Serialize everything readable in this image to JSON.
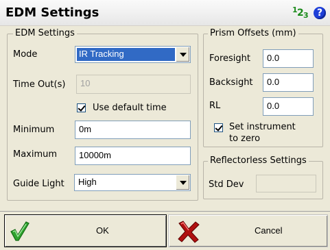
{
  "window": {
    "title": "EDM Settings"
  },
  "titlebar_icons": {
    "numeric": [
      "1",
      "2",
      "3"
    ],
    "help": "?"
  },
  "edm": {
    "legend": "EDM Settings",
    "mode_label": "Mode",
    "mode_value": "IR Tracking",
    "timeout_label": "Time Out(s)",
    "timeout_value": "10",
    "use_default_label": "Use default time",
    "use_default_checked": true,
    "minimum_label": "Minimum",
    "minimum_value": "0m",
    "maximum_label": "Maximum",
    "maximum_value": "10000m",
    "guide_label": "Guide Light",
    "guide_value": "High"
  },
  "prism": {
    "legend": "Prism Offsets (mm)",
    "foresight_label": "Foresight",
    "foresight_value": "0.0",
    "backsight_label": "Backsight",
    "backsight_value": "0.0",
    "rl_label": "RL",
    "rl_value": "0.0",
    "set_zero_line1": "Set instrument",
    "set_zero_line2": "to zero",
    "set_zero_checked": true
  },
  "reflectorless": {
    "legend": "Reflectorless Settings",
    "stddev_label": "Std Dev",
    "stddev_value": ""
  },
  "buttons": {
    "ok_label": "OK",
    "cancel_label": "Cancel",
    "ok_icon": "green-check-icon",
    "cancel_icon": "red-x-icon"
  }
}
